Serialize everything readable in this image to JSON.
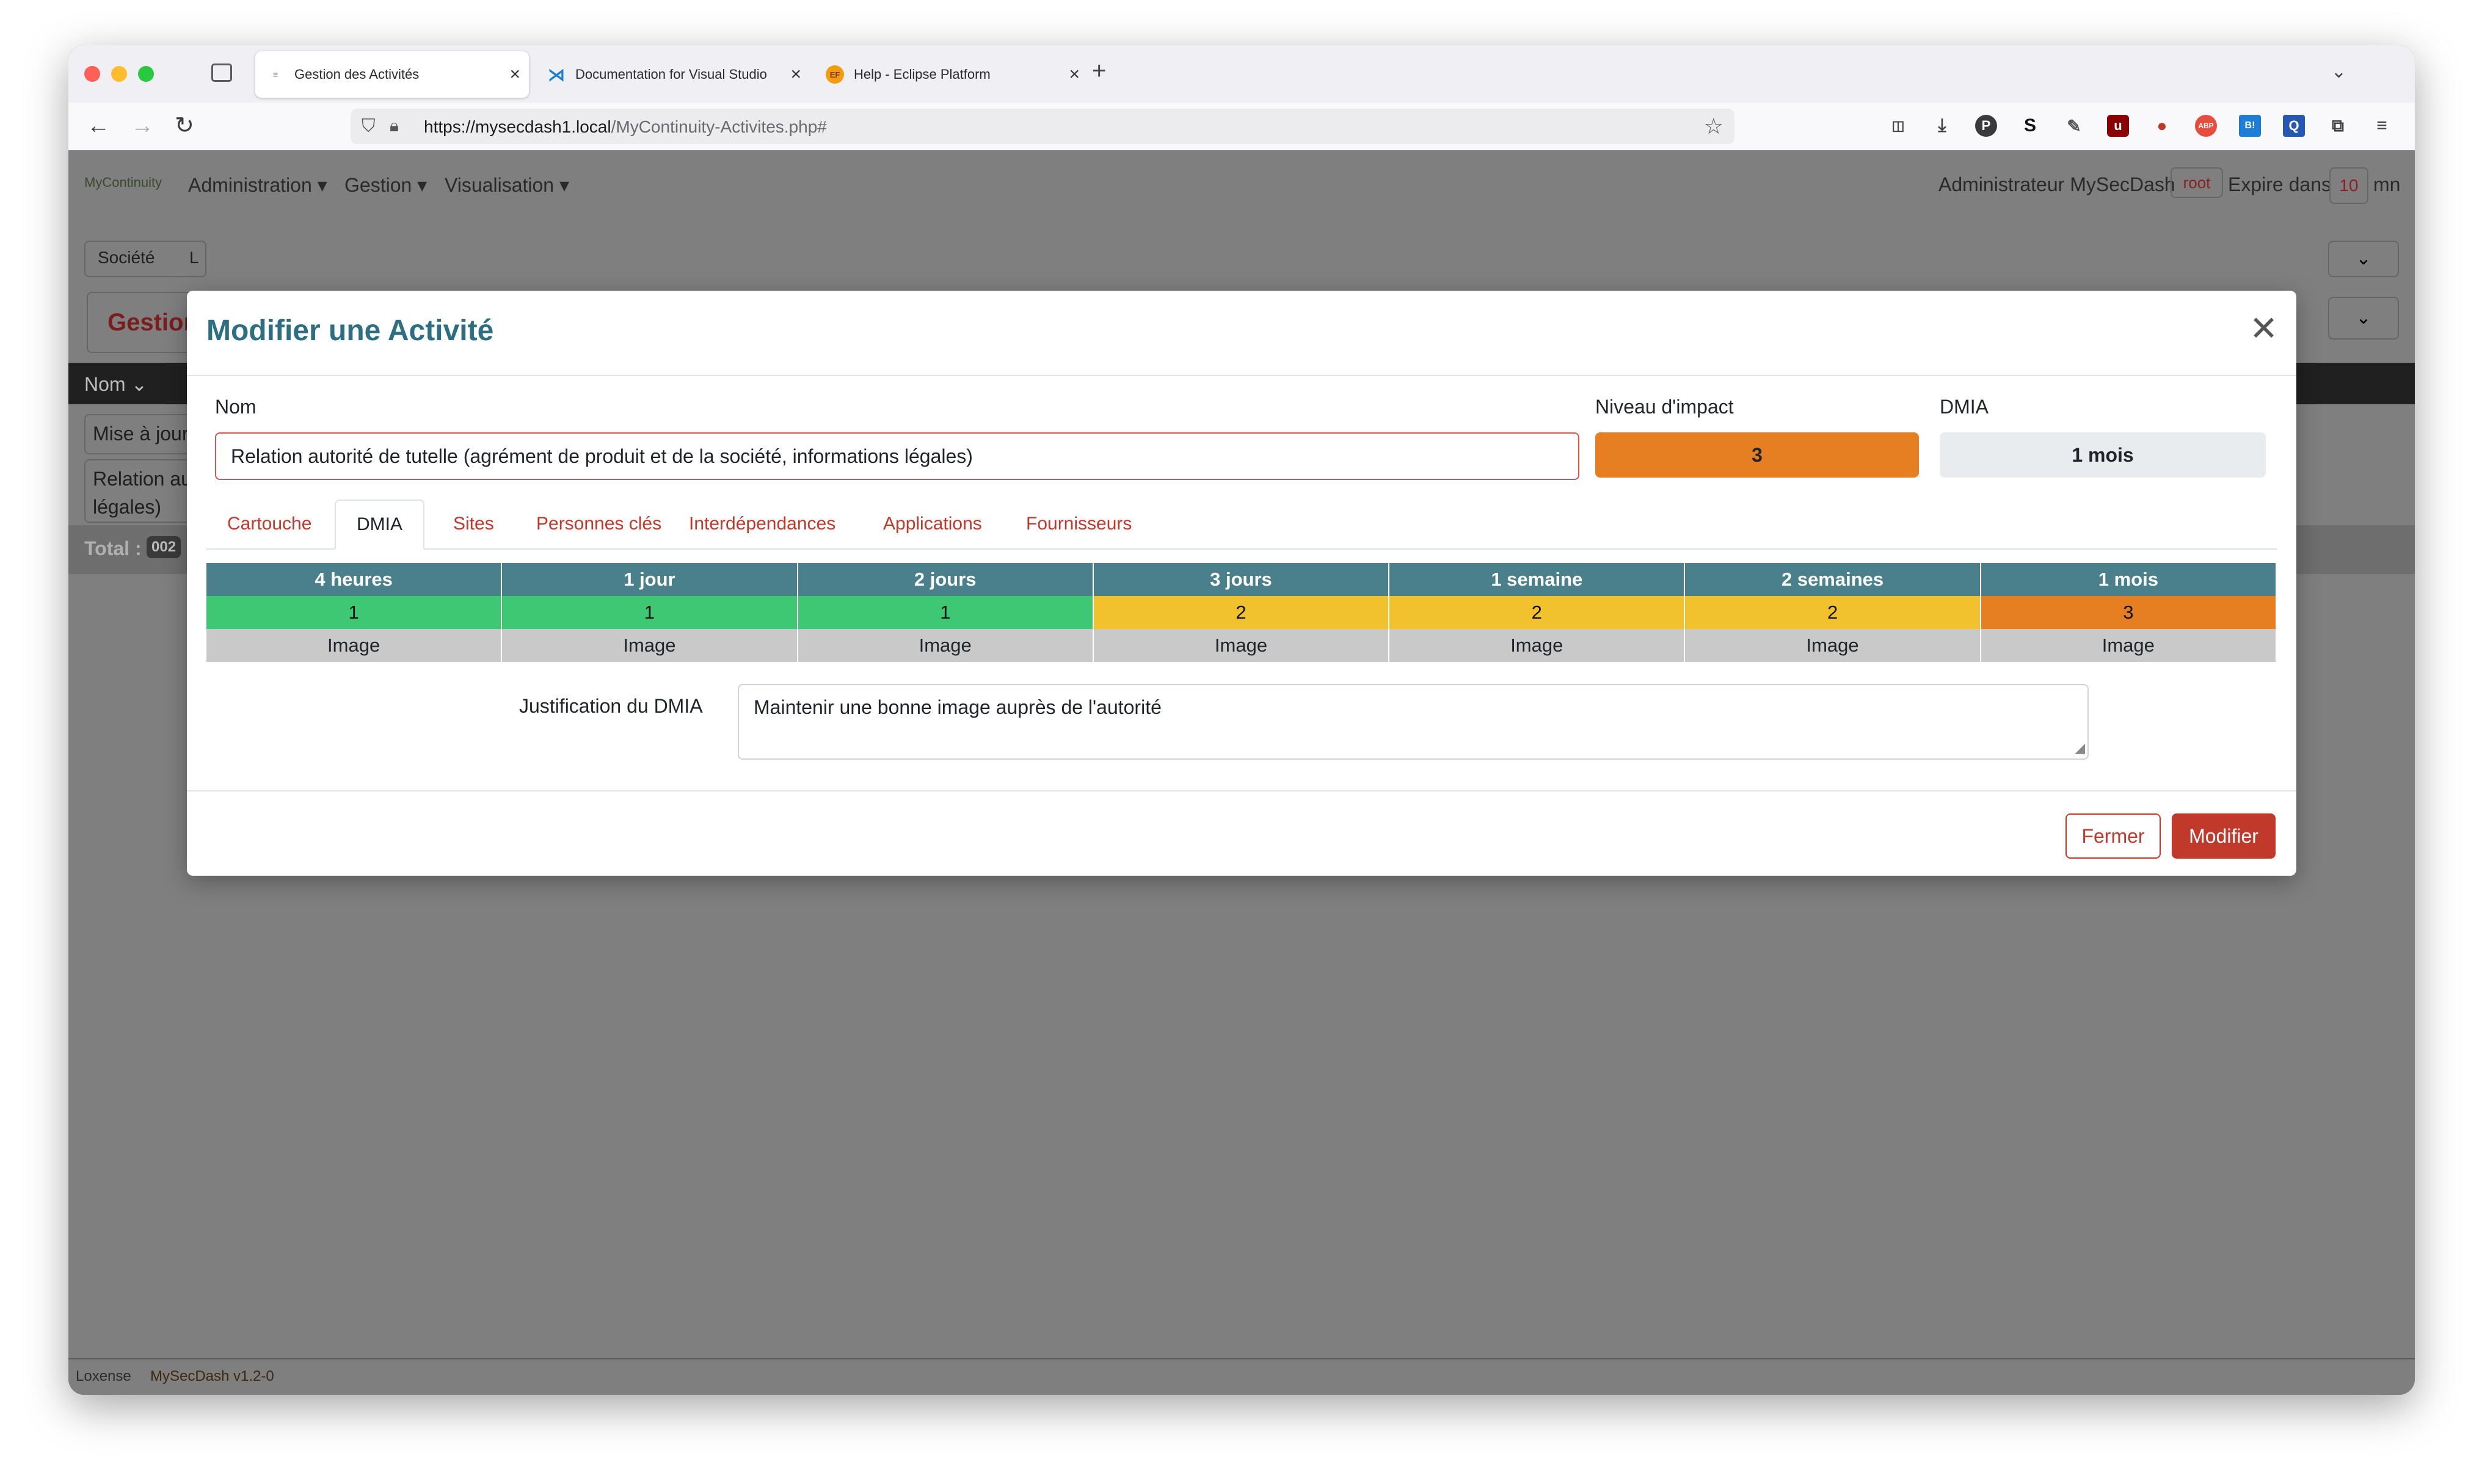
{
  "browser": {
    "tabs": [
      {
        "title": "Gestion des Activités",
        "active": true,
        "favicon": "mycontinuity-favicon"
      },
      {
        "title": "Documentation for Visual Studio",
        "active": false,
        "favicon": "vscode-favicon"
      },
      {
        "title": "Help - Eclipse Platform",
        "active": false,
        "favicon": "eclipse-favicon"
      }
    ],
    "new_tab": "+",
    "url_host": "https://mysecdash1.local",
    "url_path": "/MyContinuity-Activites.php#",
    "extensions": [
      "pocket-icon",
      "download-icon",
      "p-icon",
      "s-icon",
      "pen-icon",
      "ublock-icon",
      "cookie-icon",
      "abp-icon",
      "bookmark-icon",
      "q-icon",
      "puzzle-icon",
      "menu-icon"
    ]
  },
  "app": {
    "logo": "MyContinuity",
    "menu": [
      "Administration ▾",
      "Gestion ▾",
      "Visualisation ▾"
    ],
    "user": "Administrateur MySecDash",
    "user_badge": "root",
    "expire_label": "Expire dans",
    "expire_value": "10",
    "expire_unit": "mn",
    "filter_label": "Société",
    "filter_tail": "L",
    "page_heading": "Gestion",
    "col_header": "Nom ⌄",
    "rows": [
      "Mise à jour",
      "Relation au",
      "légales)"
    ],
    "total_label": "Total :",
    "total_value": "002",
    "footer_brand": "Loxense",
    "footer_app": "MySecDash v1.2-0"
  },
  "modal": {
    "title": "Modifier une Activité",
    "name_label": "Nom",
    "name_value": "Relation autorité de tutelle (agrément de produit et de la société, informations légales)",
    "impact_label": "Niveau d'impact",
    "impact_value": "3",
    "dmia_label": "DMIA",
    "dmia_value": "1 mois",
    "tabs": [
      "Cartouche",
      "DMIA",
      "Sites",
      "Personnes clés",
      "Interdépendances",
      "Applications",
      "Fournisseurs"
    ],
    "active_tab": "DMIA",
    "periods": [
      "4 heures",
      "1 jour",
      "2 jours",
      "3 jours",
      "1 semaine",
      "2 semaines",
      "1 mois"
    ],
    "impacts": [
      "1",
      "1",
      "1",
      "2",
      "2",
      "2",
      "3"
    ],
    "impact_colors": [
      "#3ec874",
      "#3ec874",
      "#3ec874",
      "#f2c12e",
      "#f2c12e",
      "#f2c12e",
      "#e67e22"
    ],
    "types": [
      "Image",
      "Image",
      "Image",
      "Image",
      "Image",
      "Image",
      "Image"
    ],
    "justification_label": "Justification du DMIA",
    "justification_value": "Maintenir une bonne image auprès de l'autorité",
    "btn_close": "Fermer",
    "btn_modify": "Modifier"
  },
  "colors": {
    "accent_red": "#c0392b",
    "title_teal": "#2d6f82",
    "table_header": "#4a7f8c"
  }
}
